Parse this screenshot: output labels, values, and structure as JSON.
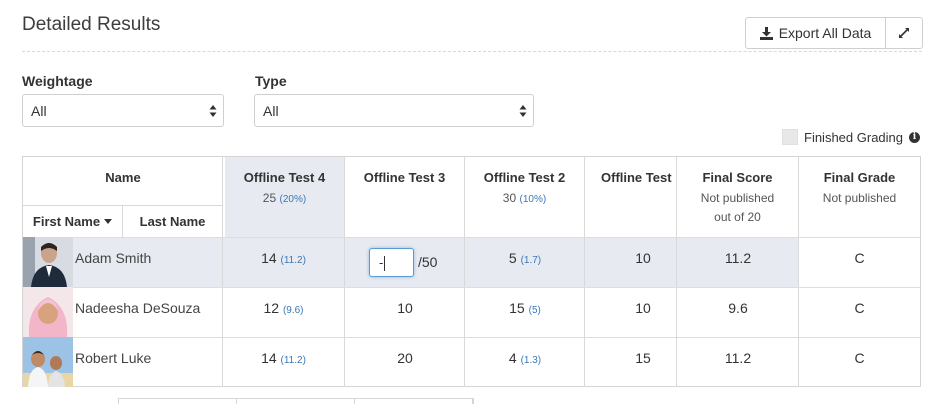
{
  "header": {
    "title": "Detailed Results",
    "export_label": "Export All Data"
  },
  "filters": {
    "weightage_label": "Weightage",
    "weightage_value": "All",
    "type_label": "Type",
    "type_value": "All"
  },
  "finished_grading_label": "Finished Grading",
  "table": {
    "name_header": "Name",
    "first_name_header": "First Name",
    "last_name_header": "Last Name",
    "columns": [
      {
        "title": "Offline Test 4",
        "max": "25",
        "weight": "(20%)"
      },
      {
        "title": "Offline Test 3"
      },
      {
        "title": "Offline Test 2",
        "max": "30",
        "weight": "(10%)"
      },
      {
        "title": "Offline Test"
      },
      {
        "title": "Final Score",
        "line1": "Not published",
        "line2": "out of 20"
      },
      {
        "title": "Final Grade",
        "line1": "Not published"
      }
    ],
    "rows": [
      {
        "name": "Adam Smith",
        "t4": "14",
        "t4w": "(11.2)",
        "t3_input": "-",
        "t3_max": "/50",
        "t2": "5",
        "t2w": "(1.7)",
        "t1": "10",
        "score": "11.2",
        "grade": "C"
      },
      {
        "name": "Nadeesha DeSouza",
        "t4": "12",
        "t4w": "(9.6)",
        "t3": "10",
        "t2": "15",
        "t2w": "(5)",
        "t1": "10",
        "score": "9.6",
        "grade": "C"
      },
      {
        "name": "Robert Luke",
        "t4": "14",
        "t4w": "(11.2)",
        "t3": "20",
        "t2": "4",
        "t2w": "(1.3)",
        "t1": "15",
        "score": "11.2",
        "grade": "C"
      }
    ]
  },
  "colors": {
    "link_blue": "#3a78b8",
    "highlight": "#e7eaf0",
    "border": "#d4d4d4"
  },
  "icons": [
    "download-icon",
    "expand-icon",
    "select-arrows-icon",
    "info-icon",
    "sort-caret-icon"
  ]
}
